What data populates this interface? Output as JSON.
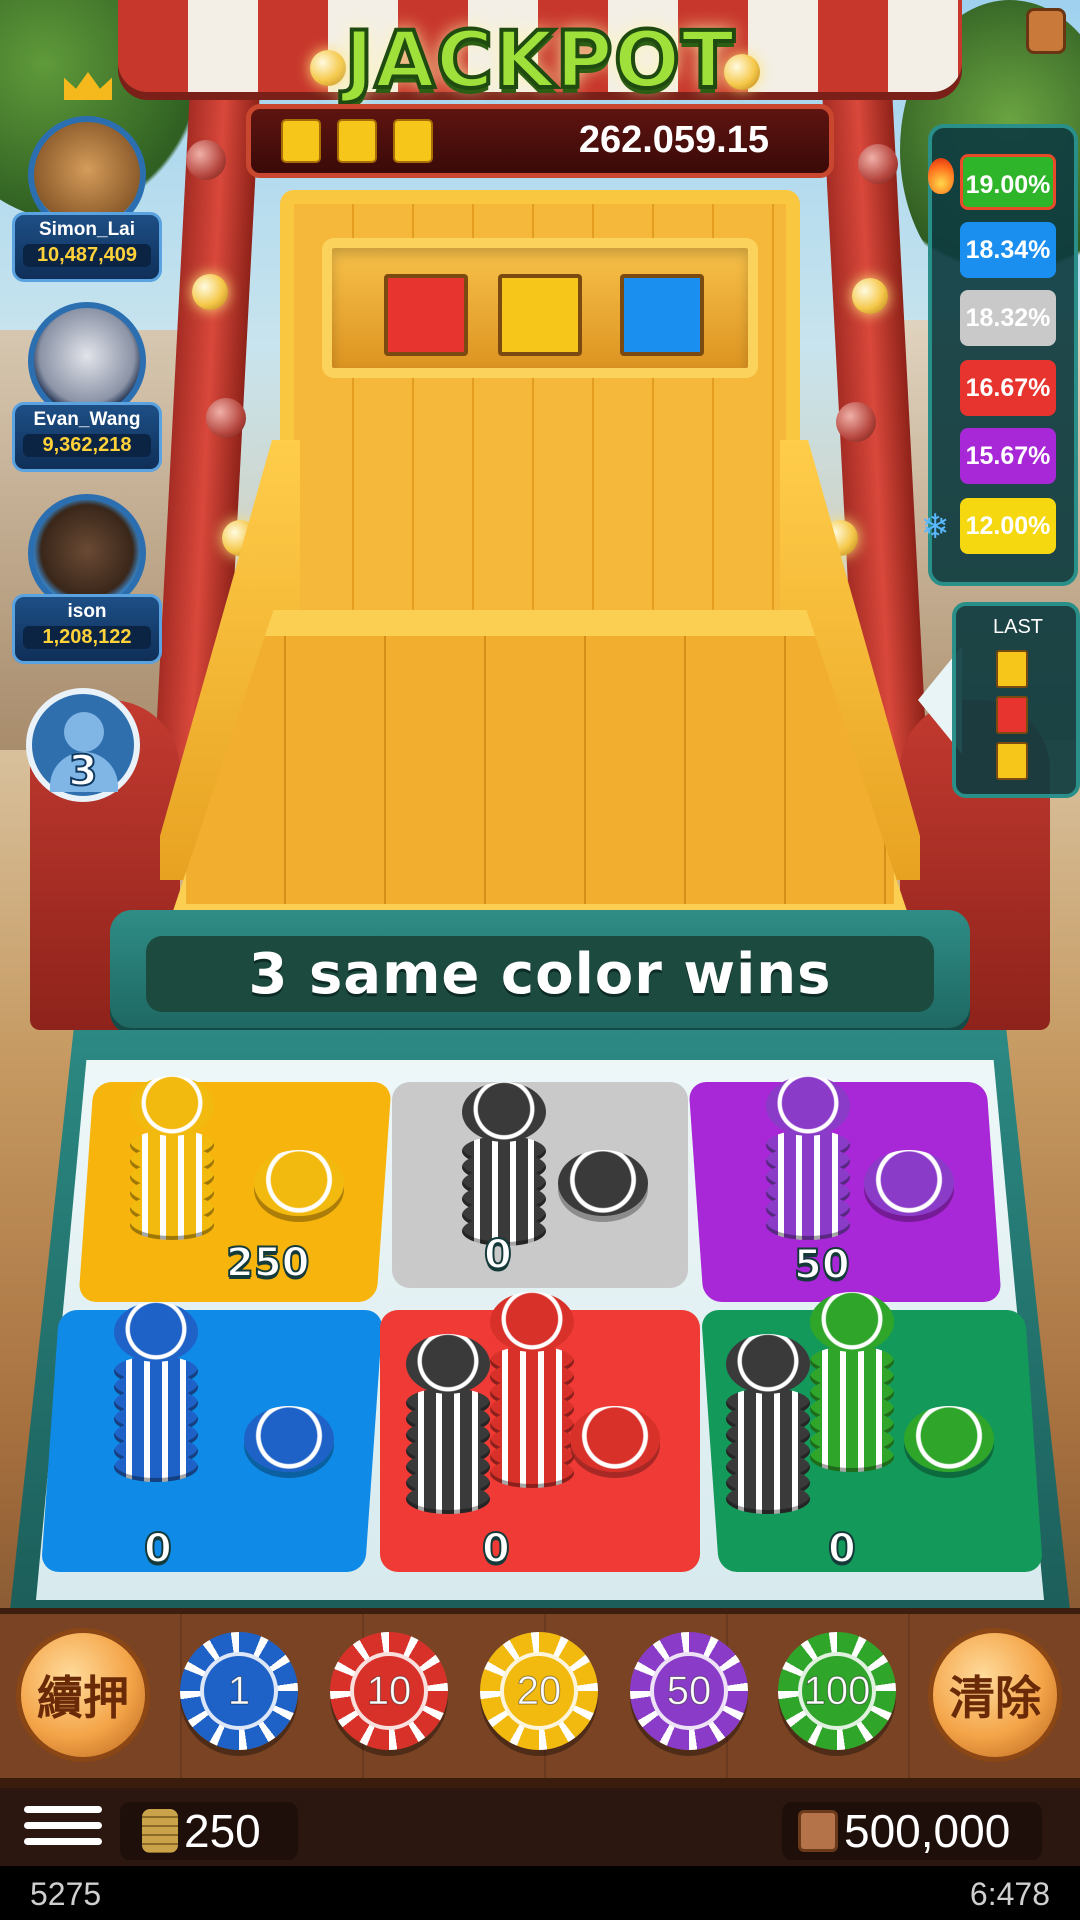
{
  "jackpot": {
    "title": "JACKPOT",
    "amount": "262.059.15",
    "slot_color": "#f7c61a"
  },
  "banner": {
    "text": "3 same color wins"
  },
  "cart_colors": [
    "#e8342e",
    "#f7c61a",
    "#1a8ff0"
  ],
  "players": [
    {
      "name": "Simon_Lai",
      "score": "10,487,409",
      "avatar_icon": "teddy-bear-avatar",
      "crown": true
    },
    {
      "name": "Evan_Wang",
      "score": "9,362,218",
      "avatar_icon": "hooded-figure-avatar",
      "crown": false
    },
    {
      "name": "ison",
      "score": "1,208,122",
      "avatar_icon": "angry-bear-avatar",
      "crown": false
    }
  ],
  "other_players": {
    "count": "3",
    "icon": "user-silhouette-icon"
  },
  "odds": [
    {
      "value": "19.00%",
      "color": "#2fb52a",
      "marker": "fire-icon"
    },
    {
      "value": "18.34%",
      "color": "#1a8ff0"
    },
    {
      "value": "18.32%",
      "color": "#c9c9c9"
    },
    {
      "value": "16.67%",
      "color": "#e8342e"
    },
    {
      "value": "15.67%",
      "color": "#a827d6"
    },
    {
      "value": "12.00%",
      "color": "#f5d810",
      "marker": "snowflake-icon"
    }
  ],
  "last": {
    "title": "LAST",
    "colors": [
      "#f7c61a",
      "#e8342e",
      "#f7c61a"
    ]
  },
  "bets": [
    {
      "color_name": "yellow",
      "color": "#f6b40c",
      "amount": "250"
    },
    {
      "color_name": "gray",
      "color": "#c9c9c9",
      "amount": "0"
    },
    {
      "color_name": "purple",
      "color": "#a827d6",
      "amount": "50"
    },
    {
      "color_name": "blue",
      "color": "#0f8ae6",
      "amount": "0"
    },
    {
      "color_name": "red",
      "color": "#ef3a35",
      "amount": "0"
    },
    {
      "color_name": "green",
      "color": "#13995a",
      "amount": "0"
    }
  ],
  "controls": {
    "rebet_label": "續押",
    "clear_label": "清除",
    "chips": [
      {
        "value": "1",
        "color": "#1f62c7"
      },
      {
        "value": "10",
        "color": "#d8312a"
      },
      {
        "value": "20",
        "color": "#f2b90e"
      },
      {
        "value": "50",
        "color": "#8a3cc8"
      },
      {
        "value": "100",
        "color": "#2fa52a"
      }
    ]
  },
  "status": {
    "bet_total": "250",
    "balance": "500,000",
    "bet_icon": "coin-stack-icon",
    "balance_icon": "wallet-icon"
  },
  "footer": {
    "left": "5275",
    "right": "6:478"
  }
}
